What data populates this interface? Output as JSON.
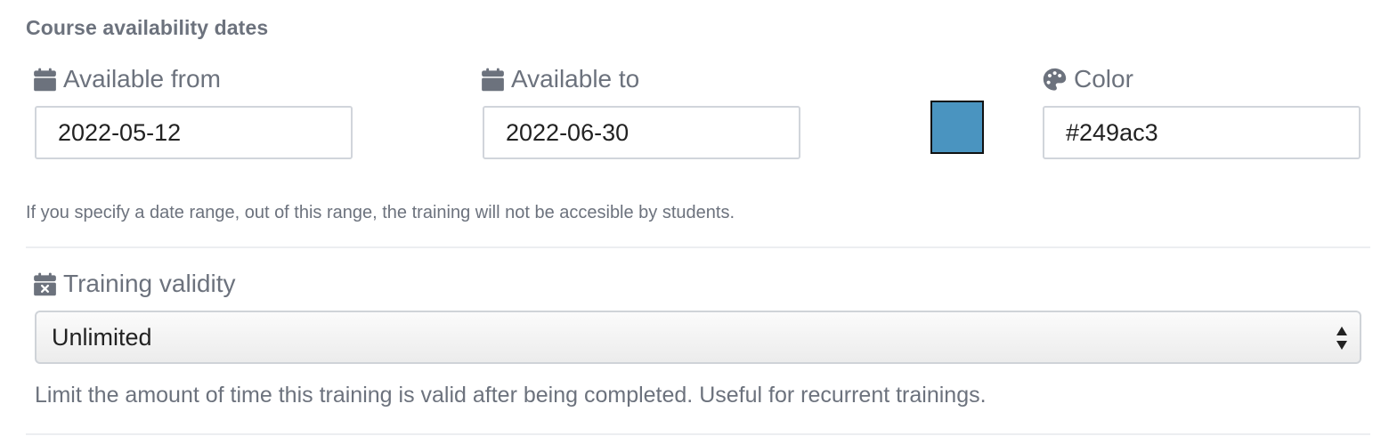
{
  "section": {
    "title": "Course availability dates"
  },
  "fields": {
    "available_from": {
      "label": "Available from",
      "value": "2022-05-12"
    },
    "available_to": {
      "label": "Available to",
      "value": "2022-06-30"
    },
    "color": {
      "label": "Color",
      "value": "#249ac3",
      "swatch_color": "#4a94c0"
    }
  },
  "date_help": "If you specify a date range, out of this range, the training will not be accesible by students.",
  "validity": {
    "label": "Training validity",
    "selected": "Unlimited",
    "help": "Limit the amount of time this training is valid after being completed. Useful for recurrent trainings."
  },
  "icons": {
    "available_from": "calendar-icon",
    "available_to": "calendar-icon",
    "color": "palette-icon",
    "validity": "calendar-x-icon",
    "select": "sort-arrows-icon"
  },
  "colors": {
    "label_text": "#6c727d",
    "input_text": "#222222",
    "border": "#d1d5db"
  }
}
